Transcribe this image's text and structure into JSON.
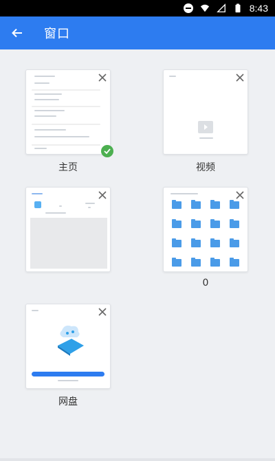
{
  "status_bar": {
    "time": "8:43"
  },
  "app_bar": {
    "title": "窗口"
  },
  "windows": [
    {
      "label": "主页"
    },
    {
      "label": "视频"
    },
    {
      "label": ""
    },
    {
      "label": "0"
    },
    {
      "label": "网盘"
    }
  ],
  "colors": {
    "accent": "#2d7cf0",
    "check": "#4caf50",
    "folder": "#4a9be8"
  },
  "icons": [
    "back-arrow-icon",
    "close-icon",
    "check-icon"
  ]
}
